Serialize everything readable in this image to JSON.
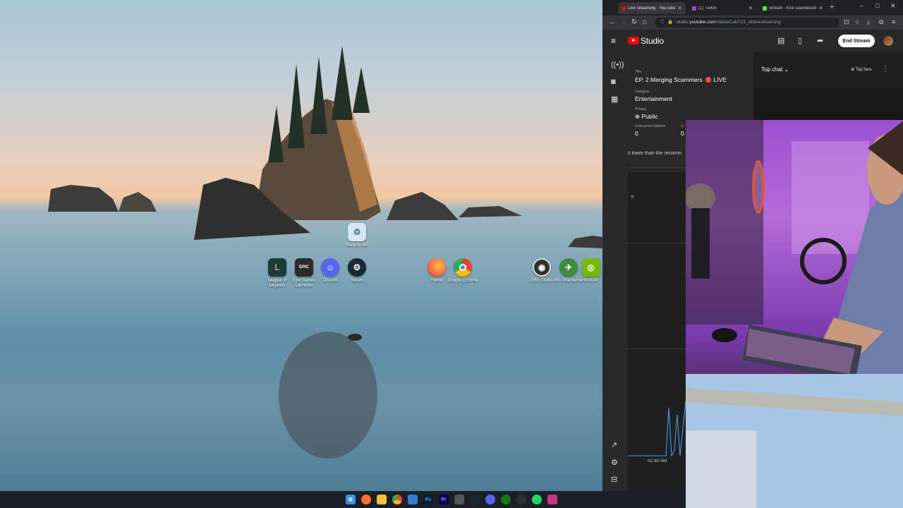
{
  "desktop": {
    "icons": [
      {
        "label": "Recycle Bin",
        "icon": "recycle-bin-icon",
        "color": "#d7e6f5"
      },
      {
        "label": "League of Legends",
        "icon": "league-of-legends-icon",
        "color": "#1b3d3a"
      },
      {
        "label": "Epic Games Launcher",
        "icon": "epic-games-icon",
        "color": "#2a2a2a",
        "glyph": "EPIC"
      },
      {
        "label": "Discord",
        "icon": "discord-icon",
        "color": "#5865f2"
      },
      {
        "label": "Steam",
        "icon": "steam-icon",
        "color": "#1b2838"
      },
      {
        "label": "Firefox",
        "icon": "firefox-icon",
        "color": "#ff7139"
      },
      {
        "label": "Google Chrome",
        "icon": "chrome-icon",
        "color": "#4285f4"
      },
      {
        "label": "OBS Studio",
        "icon": "obs-icon",
        "color": "#302e31"
      },
      {
        "label": "MSI Afterburner",
        "icon": "msi-afterburner-icon",
        "color": "#3c8d3c"
      },
      {
        "label": "NVIDIA",
        "icon": "nvidia-icon",
        "color": "#76b900"
      }
    ]
  },
  "browser": {
    "tabs": [
      {
        "title": "Live streaming - YouTube Studio",
        "favicon_color": "#ff0000",
        "active": true
      },
      {
        "title": "(1) Twitch",
        "favicon_color": "#9146ff",
        "active": false
      },
      {
        "title": "Stream - Kick Dashboard",
        "favicon_color": "#53fc18",
        "active": false
      }
    ],
    "new_tab": "+",
    "window_controls": {
      "minimize": "–",
      "maximize": "□",
      "close": "✕"
    },
    "url_prefix": "studio.",
    "url_domain": "youtube.com",
    "url_path": "/video/CabYZ1_t8/livestreaming"
  },
  "studio": {
    "brand": "Studio",
    "end_stream": "End Stream",
    "title_label": "Title",
    "title_value": "EP. 2 Merging Scammers",
    "live_badge": "LIVE",
    "category_label": "Category",
    "category_value": "Entertainment",
    "privacy_label": "Privacy",
    "privacy_value": "Public",
    "viewers_label": "Concurrent viewers",
    "viewers_value": "0",
    "likes_label": "Li",
    "likes_value": "0",
    "warning": "s lower than the recomm",
    "chat_mode": "Top chat",
    "top_fans": "Top fans",
    "chart_time": "02:40 AM"
  },
  "taskbar": {
    "icons": [
      {
        "name": "start-icon",
        "color": "#3b8fe6"
      },
      {
        "name": "firefox-icon",
        "color": "#ff7139"
      },
      {
        "name": "file-explorer-icon",
        "color": "#f3c23e"
      },
      {
        "name": "chrome-icon",
        "color": "#4285f4"
      },
      {
        "name": "notepad-icon",
        "color": "#3a7bd5"
      },
      {
        "name": "photoshop-icon",
        "color": "#001e36",
        "glyph": "Ps"
      },
      {
        "name": "premiere-icon",
        "color": "#00005b",
        "glyph": "Pr"
      },
      {
        "name": "calculator-icon",
        "color": "#555555"
      },
      {
        "name": "steam-icon",
        "color": "#1b2838"
      },
      {
        "name": "discord-icon",
        "color": "#5865f2"
      },
      {
        "name": "xbox-icon",
        "color": "#107c10"
      },
      {
        "name": "obs-icon",
        "color": "#302e31"
      },
      {
        "name": "whatsapp-icon",
        "color": "#25d366"
      },
      {
        "name": "app-icon",
        "color": "#c13584"
      }
    ]
  }
}
